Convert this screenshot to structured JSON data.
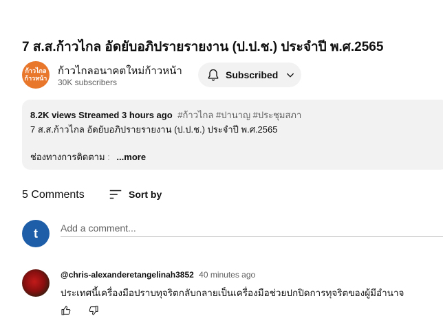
{
  "video": {
    "title": "7 ส.ส.ก้าวไกล อัดยับอภิปรายรายงาน (ป.ป.ช.) ประจำปี พ.ศ.2565"
  },
  "channel": {
    "avatar_text": "ก้าวไกล ก้าวหน้า",
    "name": "ก้าวไกลอนาคตใหม่ก้าวหน้า",
    "subscribers": "30K subscribers",
    "subscribe_label": "Subscribed"
  },
  "description": {
    "views": "8.2K views",
    "streamed": "Streamed 3 hours ago",
    "tags": "#ก้าวไกล #ปานาญ #ประชุมสภา",
    "line2": "7 ส.ส.ก้าวไกล อัดยับอภิปรายรายงาน (ป.ป.ช.) ประจำปี พ.ศ.2565",
    "line3": "ช่องทางการติดตาม",
    "separator": ":",
    "more_label": "...more"
  },
  "comments": {
    "count_label": "5 Comments",
    "sort_label": "Sort by",
    "my_avatar_letter": "t",
    "add_placeholder": "Add a comment...",
    "items": [
      {
        "author": "@chris-alexanderetangelinah3852",
        "time": "40 minutes ago",
        "text": "ประเทศนี้เครื่องมือปราบทุจริตกลับกลายเป็นเครื่องมือช่วยปกปิดการทุจริตของผู้มีอำนาจ"
      }
    ]
  },
  "icons": {
    "bell": "bell-icon",
    "chevron": "chevron-down-icon",
    "sort": "sort-icon",
    "like": "thumb-up-icon",
    "dislike": "thumb-down-icon"
  }
}
